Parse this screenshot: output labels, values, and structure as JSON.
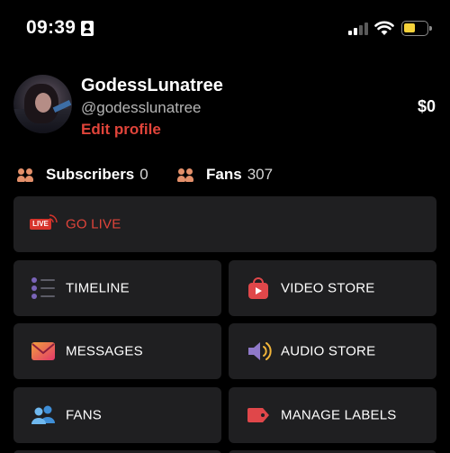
{
  "status_bar": {
    "time": "09:39"
  },
  "profile": {
    "display_name": "GodessLunatree",
    "handle": "@godesslunatree",
    "edit_label": "Edit profile",
    "balance": "$0"
  },
  "stats": {
    "subscribers_label": "Subscribers",
    "subscribers_count": "0",
    "fans_label": "Fans",
    "fans_count": "307"
  },
  "menu": {
    "go_live": "GO LIVE",
    "live_badge": "LIVE",
    "timeline": "TIMELINE",
    "video_store": "VIDEO STORE",
    "messages": "MESSAGES",
    "audio_store": "AUDIO STORE",
    "fans": "FANS",
    "manage_labels": "MANAGE LABELS"
  },
  "colors": {
    "accent_red": "#e0443a",
    "tile_bg": "#1f1f21",
    "battery": "#f5d23a"
  },
  "icons": [
    "id-card-icon",
    "cellular-signal-icon",
    "wifi-icon",
    "battery-icon",
    "people-icon",
    "live-icon",
    "timeline-list-icon",
    "video-bag-icon",
    "envelope-icon",
    "speaker-icon",
    "fans-people-icon",
    "label-tag-icon"
  ]
}
